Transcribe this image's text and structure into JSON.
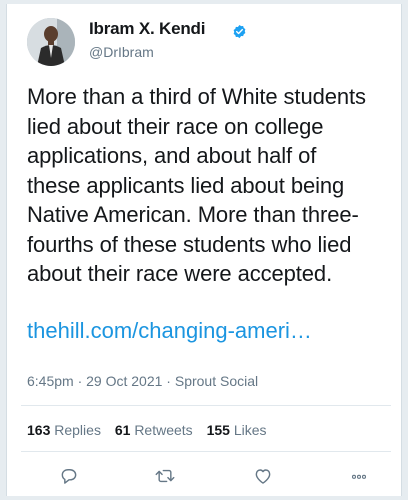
{
  "author": {
    "name": "Ibram X. Kendi",
    "handle": "@DrIbram",
    "verified_icon": "verified-badge-icon"
  },
  "tweet": {
    "lines": [
      "More than a third of White students",
      "lied about their race on college",
      "applications, and about half of",
      "these applicants lied about being",
      "Native American. More than three-",
      "fourths of these students who lied",
      "about their race were accepted."
    ],
    "link": "thehill.com/changing-ameri…",
    "meta": "6:45pm · 29 Oct 2021 · Sprout Social"
  },
  "stats": {
    "replies_count": "163",
    "replies_label": "Replies",
    "retweets_count": "61",
    "retweets_label": "Retweets",
    "likes_count": "155",
    "likes_label": "Likes"
  },
  "actions": {
    "reply_icon": "reply-icon",
    "retweet_icon": "retweet-icon",
    "like_icon": "heart-icon",
    "more_icon": "more-icon"
  },
  "colors": {
    "link": "#1b95e0",
    "secondary_text": "#657786",
    "primary_text": "#14171a",
    "verified": "#1da1f2"
  }
}
